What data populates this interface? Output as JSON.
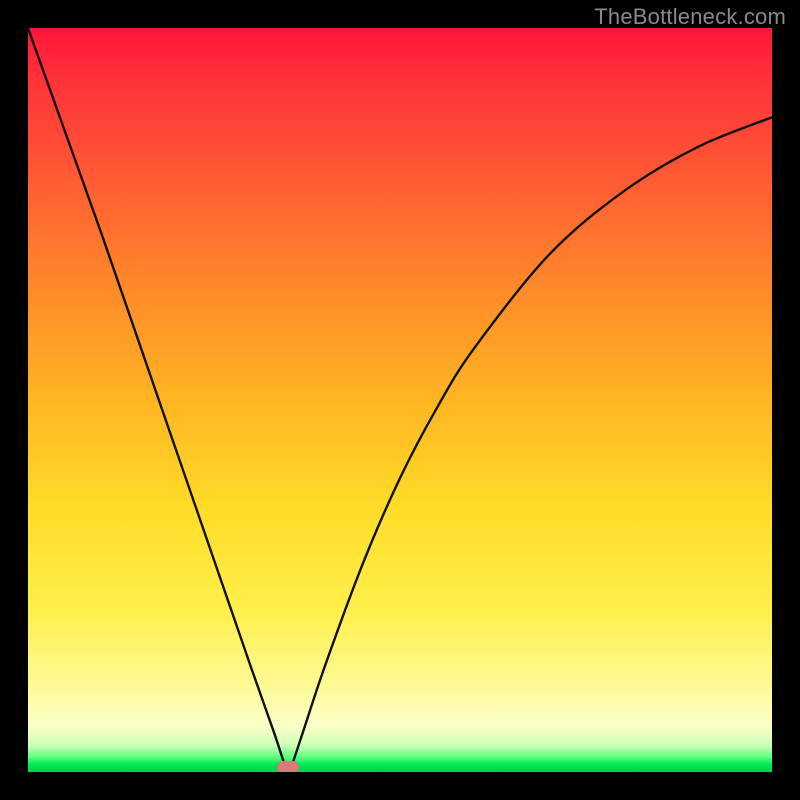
{
  "watermark": "TheBottleneck.com",
  "colors": {
    "frame": "#000000",
    "curve_stroke": "#111111",
    "marker": "#d87a77",
    "watermark_text": "#8a8a8a"
  },
  "chart_data": {
    "type": "line",
    "title": "",
    "xlabel": "",
    "ylabel": "",
    "xlim": [
      0,
      1
    ],
    "ylim": [
      0,
      1
    ],
    "background_gradient": {
      "direction": "vertical",
      "top_meaning": "high_bottleneck",
      "bottom_meaning": "no_bottleneck",
      "stops": [
        {
          "pos": 0.0,
          "color": "#ff153b"
        },
        {
          "pos": 0.2,
          "color": "#ff5a33"
        },
        {
          "pos": 0.5,
          "color": "#ffb522"
        },
        {
          "pos": 0.78,
          "color": "#ffef4a"
        },
        {
          "pos": 0.95,
          "color": "#fbffca"
        },
        {
          "pos": 1.0,
          "color": "#00d24a"
        }
      ]
    },
    "series": [
      {
        "name": "bottleneck-curve",
        "x": [
          0.0,
          0.05,
          0.1,
          0.15,
          0.2,
          0.25,
          0.3,
          0.33,
          0.345,
          0.35,
          0.355,
          0.37,
          0.4,
          0.45,
          0.5,
          0.55,
          0.6,
          0.7,
          0.8,
          0.9,
          1.0
        ],
        "y": [
          1.0,
          0.86,
          0.72,
          0.575,
          0.43,
          0.285,
          0.14,
          0.055,
          0.01,
          0.0,
          0.01,
          0.055,
          0.145,
          0.28,
          0.395,
          0.49,
          0.57,
          0.695,
          0.78,
          0.84,
          0.88
        ]
      }
    ],
    "marker": {
      "x": 0.35,
      "y": 0.0
    }
  }
}
